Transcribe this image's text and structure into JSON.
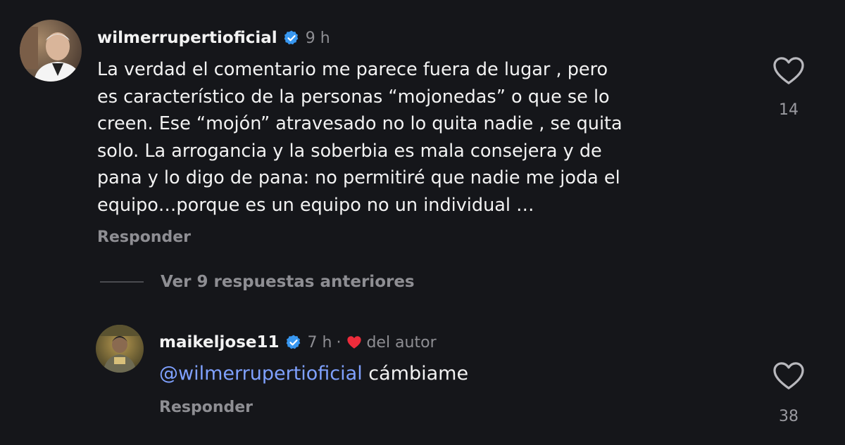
{
  "theme": {
    "background": "#15161a",
    "text": "#f2f2f2",
    "muted": "#8e8e93",
    "verified": "#3897f0",
    "mention": "#7fa1ff",
    "author_heart": "#ed2c3b"
  },
  "comment": {
    "avatar_icon": "profile-photo-avatar",
    "username": "wilmerrupertioficial",
    "verified_icon": "verified-badge-icon",
    "time": "9 h",
    "lines": [
      "La verdad el comentario me parece fuera de lugar , pero",
      "es característico de la personas “mojonedas” o que se lo",
      "creen. Ese “mojón” atravesado no lo quita nadie , se quita",
      "solo. La arrogancia y la soberbia es mala consejera y de",
      "pana y lo digo de pana: no permitiré que nadie me joda el",
      "equipo…porque es un equipo no un individual …"
    ],
    "reply_label": "Responder",
    "like_icon": "heart-outline-icon",
    "likes": "14"
  },
  "view_replies": {
    "label": "Ver 9 respuestas anteriores"
  },
  "reply": {
    "avatar_icon": "profile-photo-avatar",
    "username": "maikeljose11",
    "verified_icon": "verified-badge-icon",
    "time": "7 h",
    "separator": "·",
    "author_heart_icon": "red-heart-icon",
    "author_label": "del autor",
    "mention": "@wilmerrupertioficial",
    "text": "cámbiame",
    "reply_label": "Responder",
    "like_icon": "heart-outline-icon",
    "likes": "38"
  }
}
